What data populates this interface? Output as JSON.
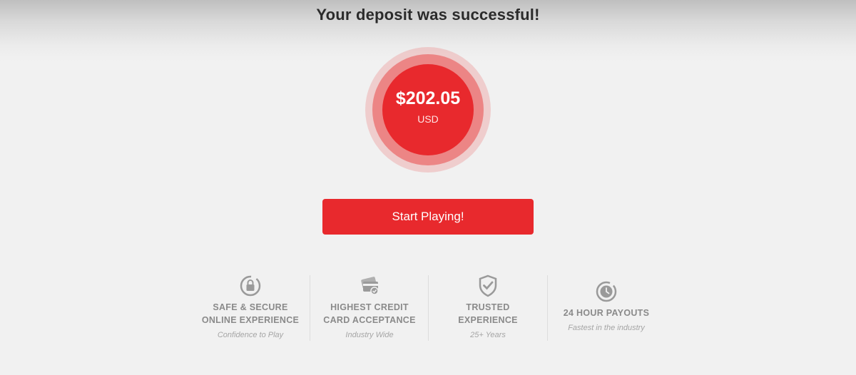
{
  "header": {
    "title": "Your deposit was successful!"
  },
  "deposit": {
    "amount": "$202.05",
    "currency": "USD"
  },
  "actions": {
    "start_label": "Start Playing!"
  },
  "features": [
    {
      "icon": "lock-icon",
      "line1": "SAFE & SECURE",
      "line2": "ONLINE EXPERIENCE",
      "sub": "Confidence to Play"
    },
    {
      "icon": "credit-card-icon",
      "line1": "HIGHEST CREDIT",
      "line2": "CARD ACCEPTANCE",
      "sub": "Industry Wide"
    },
    {
      "icon": "shield-check-icon",
      "line1": "TRUSTED",
      "line2": "EXPERIENCE",
      "sub": "25+ Years"
    },
    {
      "icon": "clock-icon",
      "line1": "24 HOUR PAYOUTS",
      "line2": "",
      "sub": "Fastest in the industry"
    }
  ],
  "colors": {
    "accent": "#e8292d",
    "background": "#f1f1f1",
    "feature_text": "#8a8a8a"
  }
}
